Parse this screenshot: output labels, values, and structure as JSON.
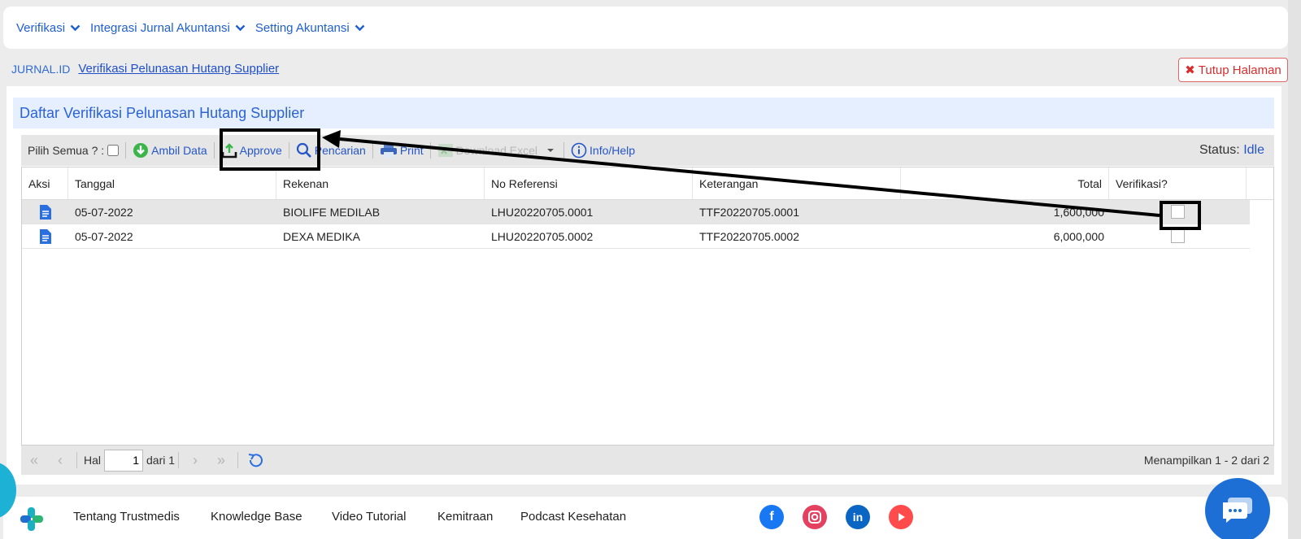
{
  "top_nav": [
    {
      "label": "Verifikasi"
    },
    {
      "label": "Integrasi Jurnal Akuntansi"
    },
    {
      "label": "Setting Akuntansi"
    }
  ],
  "breadcrumb": {
    "root": "JURNAL.ID",
    "current": "Verifikasi Pelunasan Hutang Supplier"
  },
  "close_button": "Tutup Halaman",
  "panel_title": "Daftar Verifikasi Pelunasan Hutang Supplier",
  "toolbar": {
    "select_all": "Pilih Semua ? :",
    "ambil_data": "Ambil Data",
    "approve": "Approve",
    "pencarian": "Pencarian",
    "print": "Print",
    "download_excel": "Download Excel",
    "info_help": "Info/Help",
    "status_label": "Status:",
    "status_value": "Idle"
  },
  "table": {
    "columns": [
      "Aksi",
      "Tanggal",
      "Rekenan",
      "No Referensi",
      "Keterangan",
      "Total",
      "Verifikasi?"
    ],
    "rows": [
      {
        "tanggal": "05-07-2022",
        "rekenan": "BIOLIFE MEDILAB",
        "no_ref": "LHU20220705.0001",
        "keterangan": "TTF20220705.0001",
        "total": "1,600,000",
        "verified": false,
        "selected": true
      },
      {
        "tanggal": "05-07-2022",
        "rekenan": "DEXA MEDIKA",
        "no_ref": "LHU20220705.0002",
        "keterangan": "TTF20220705.0002",
        "total": "6,000,000",
        "verified": false,
        "selected": false
      }
    ]
  },
  "pager": {
    "hal_label": "Hal",
    "page": "1",
    "dari_label": "dari 1",
    "info": "Menampilkan 1 - 2 dari 2"
  },
  "footer": {
    "links": [
      "Tentang Trustmedis",
      "Knowledge Base",
      "Video Tutorial",
      "Kemitraan",
      "Podcast Kesehatan"
    ],
    "social": [
      "facebook-icon",
      "instagram-icon",
      "linkedin-icon",
      "youtube-icon"
    ]
  },
  "colors": {
    "accent": "#1f5fd1",
    "danger": "#d92d2d",
    "header_bg": "#e5efff"
  }
}
